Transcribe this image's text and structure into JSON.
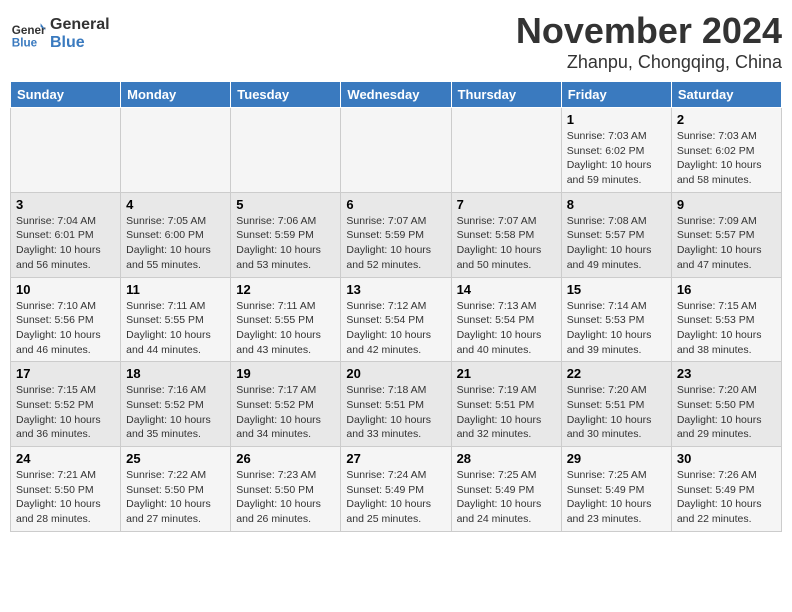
{
  "logo": {
    "name": "General",
    "name2": "Blue"
  },
  "title": "November 2024",
  "location": "Zhanpu, Chongqing, China",
  "days_of_week": [
    "Sunday",
    "Monday",
    "Tuesday",
    "Wednesday",
    "Thursday",
    "Friday",
    "Saturday"
  ],
  "weeks": [
    [
      {
        "day": "",
        "info": ""
      },
      {
        "day": "",
        "info": ""
      },
      {
        "day": "",
        "info": ""
      },
      {
        "day": "",
        "info": ""
      },
      {
        "day": "",
        "info": ""
      },
      {
        "day": "1",
        "info": "Sunrise: 7:03 AM\nSunset: 6:02 PM\nDaylight: 10 hours and 59 minutes."
      },
      {
        "day": "2",
        "info": "Sunrise: 7:03 AM\nSunset: 6:02 PM\nDaylight: 10 hours and 58 minutes."
      }
    ],
    [
      {
        "day": "3",
        "info": "Sunrise: 7:04 AM\nSunset: 6:01 PM\nDaylight: 10 hours and 56 minutes."
      },
      {
        "day": "4",
        "info": "Sunrise: 7:05 AM\nSunset: 6:00 PM\nDaylight: 10 hours and 55 minutes."
      },
      {
        "day": "5",
        "info": "Sunrise: 7:06 AM\nSunset: 5:59 PM\nDaylight: 10 hours and 53 minutes."
      },
      {
        "day": "6",
        "info": "Sunrise: 7:07 AM\nSunset: 5:59 PM\nDaylight: 10 hours and 52 minutes."
      },
      {
        "day": "7",
        "info": "Sunrise: 7:07 AM\nSunset: 5:58 PM\nDaylight: 10 hours and 50 minutes."
      },
      {
        "day": "8",
        "info": "Sunrise: 7:08 AM\nSunset: 5:57 PM\nDaylight: 10 hours and 49 minutes."
      },
      {
        "day": "9",
        "info": "Sunrise: 7:09 AM\nSunset: 5:57 PM\nDaylight: 10 hours and 47 minutes."
      }
    ],
    [
      {
        "day": "10",
        "info": "Sunrise: 7:10 AM\nSunset: 5:56 PM\nDaylight: 10 hours and 46 minutes."
      },
      {
        "day": "11",
        "info": "Sunrise: 7:11 AM\nSunset: 5:55 PM\nDaylight: 10 hours and 44 minutes."
      },
      {
        "day": "12",
        "info": "Sunrise: 7:11 AM\nSunset: 5:55 PM\nDaylight: 10 hours and 43 minutes."
      },
      {
        "day": "13",
        "info": "Sunrise: 7:12 AM\nSunset: 5:54 PM\nDaylight: 10 hours and 42 minutes."
      },
      {
        "day": "14",
        "info": "Sunrise: 7:13 AM\nSunset: 5:54 PM\nDaylight: 10 hours and 40 minutes."
      },
      {
        "day": "15",
        "info": "Sunrise: 7:14 AM\nSunset: 5:53 PM\nDaylight: 10 hours and 39 minutes."
      },
      {
        "day": "16",
        "info": "Sunrise: 7:15 AM\nSunset: 5:53 PM\nDaylight: 10 hours and 38 minutes."
      }
    ],
    [
      {
        "day": "17",
        "info": "Sunrise: 7:15 AM\nSunset: 5:52 PM\nDaylight: 10 hours and 36 minutes."
      },
      {
        "day": "18",
        "info": "Sunrise: 7:16 AM\nSunset: 5:52 PM\nDaylight: 10 hours and 35 minutes."
      },
      {
        "day": "19",
        "info": "Sunrise: 7:17 AM\nSunset: 5:52 PM\nDaylight: 10 hours and 34 minutes."
      },
      {
        "day": "20",
        "info": "Sunrise: 7:18 AM\nSunset: 5:51 PM\nDaylight: 10 hours and 33 minutes."
      },
      {
        "day": "21",
        "info": "Sunrise: 7:19 AM\nSunset: 5:51 PM\nDaylight: 10 hours and 32 minutes."
      },
      {
        "day": "22",
        "info": "Sunrise: 7:20 AM\nSunset: 5:51 PM\nDaylight: 10 hours and 30 minutes."
      },
      {
        "day": "23",
        "info": "Sunrise: 7:20 AM\nSunset: 5:50 PM\nDaylight: 10 hours and 29 minutes."
      }
    ],
    [
      {
        "day": "24",
        "info": "Sunrise: 7:21 AM\nSunset: 5:50 PM\nDaylight: 10 hours and 28 minutes."
      },
      {
        "day": "25",
        "info": "Sunrise: 7:22 AM\nSunset: 5:50 PM\nDaylight: 10 hours and 27 minutes."
      },
      {
        "day": "26",
        "info": "Sunrise: 7:23 AM\nSunset: 5:50 PM\nDaylight: 10 hours and 26 minutes."
      },
      {
        "day": "27",
        "info": "Sunrise: 7:24 AM\nSunset: 5:49 PM\nDaylight: 10 hours and 25 minutes."
      },
      {
        "day": "28",
        "info": "Sunrise: 7:25 AM\nSunset: 5:49 PM\nDaylight: 10 hours and 24 minutes."
      },
      {
        "day": "29",
        "info": "Sunrise: 7:25 AM\nSunset: 5:49 PM\nDaylight: 10 hours and 23 minutes."
      },
      {
        "day": "30",
        "info": "Sunrise: 7:26 AM\nSunset: 5:49 PM\nDaylight: 10 hours and 22 minutes."
      }
    ]
  ]
}
